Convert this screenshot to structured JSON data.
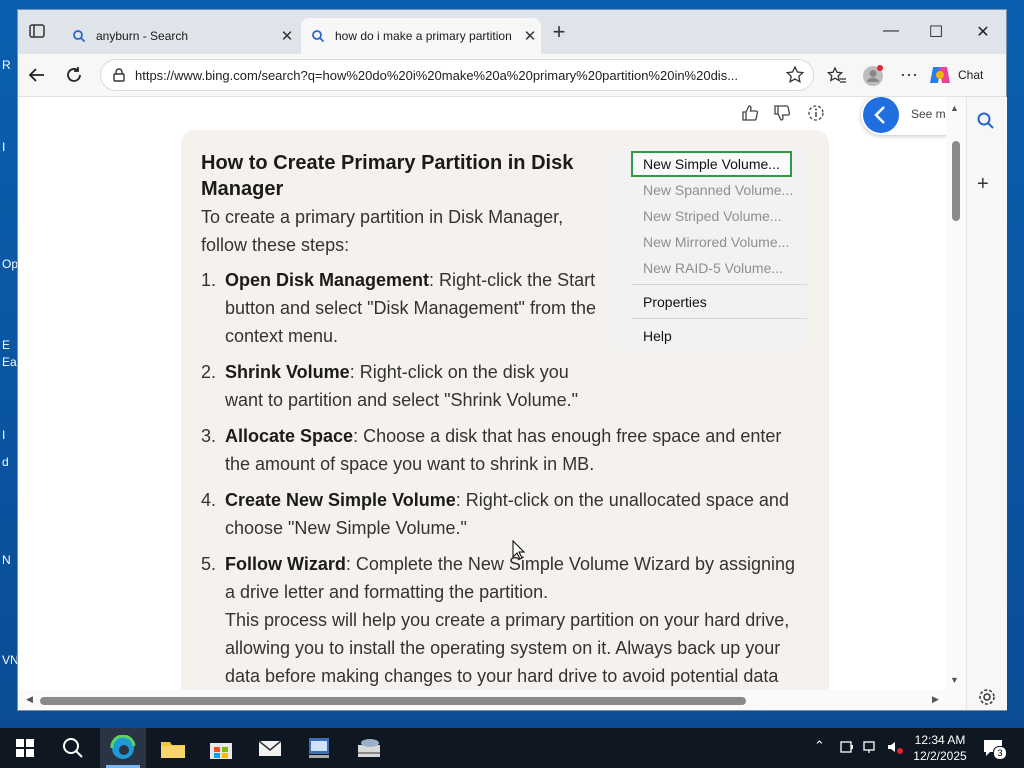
{
  "desktop": {
    "labels": [
      "R",
      "I",
      "Op",
      "E",
      "Ea",
      "I",
      "d",
      "N",
      "VN"
    ]
  },
  "browser": {
    "tabs": [
      {
        "title": "anyburn - Search",
        "active": false
      },
      {
        "title": "how do i make a primary partition",
        "active": true
      }
    ],
    "url": "https://www.bing.com/search?q=how%20do%20i%20make%20a%20primary%20partition%20in%20dis...",
    "chat_label": "Chat",
    "see_more_label": "See m"
  },
  "answer": {
    "heading": "How to Create Primary Partition in Disk Manager",
    "intro": "To create a primary partition in Disk Manager, follow these steps:",
    "steps": [
      {
        "num": "1.",
        "bold": "Open Disk Management",
        "text": ": Right-click the Start button and select \"Disk Management\" from the context menu."
      },
      {
        "num": "2.",
        "bold": "Shrink Volume",
        "text": ": Right-click on the disk you want to partition and select \"Shrink Volume.\""
      },
      {
        "num": "3.",
        "bold": "Allocate Space",
        "text": ": Choose a disk that has enough free space and enter the amount of space you want to shrink in MB."
      },
      {
        "num": "4.",
        "bold": "Create New Simple Volume",
        "text": ": Right-click on the unallocated space and choose \"New Simple Volume.\""
      },
      {
        "num": "5.",
        "bold": "Follow Wizard",
        "text": ": Complete the New Simple Volume Wizard by assigning a drive letter and formatting the partition."
      }
    ],
    "outro": "This process will help you create a primary partition on your hard drive, allowing you to install the operating system on it. Always back up your data before making changes to your hard drive to avoid potential data"
  },
  "context_menu_image": {
    "items": [
      "New Simple Volume...",
      "New Spanned Volume...",
      "New Striped Volume...",
      "New Mirrored Volume...",
      "New RAID-5 Volume...",
      "Properties",
      "Help"
    ]
  },
  "taskbar": {
    "time": "12:34 AM",
    "date": "12/2/2025",
    "notification_count": "3"
  },
  "colors": {
    "accent": "#1f6fe0",
    "card_bg": "#f5f1ed",
    "menu_highlight": "#2f9b45"
  }
}
